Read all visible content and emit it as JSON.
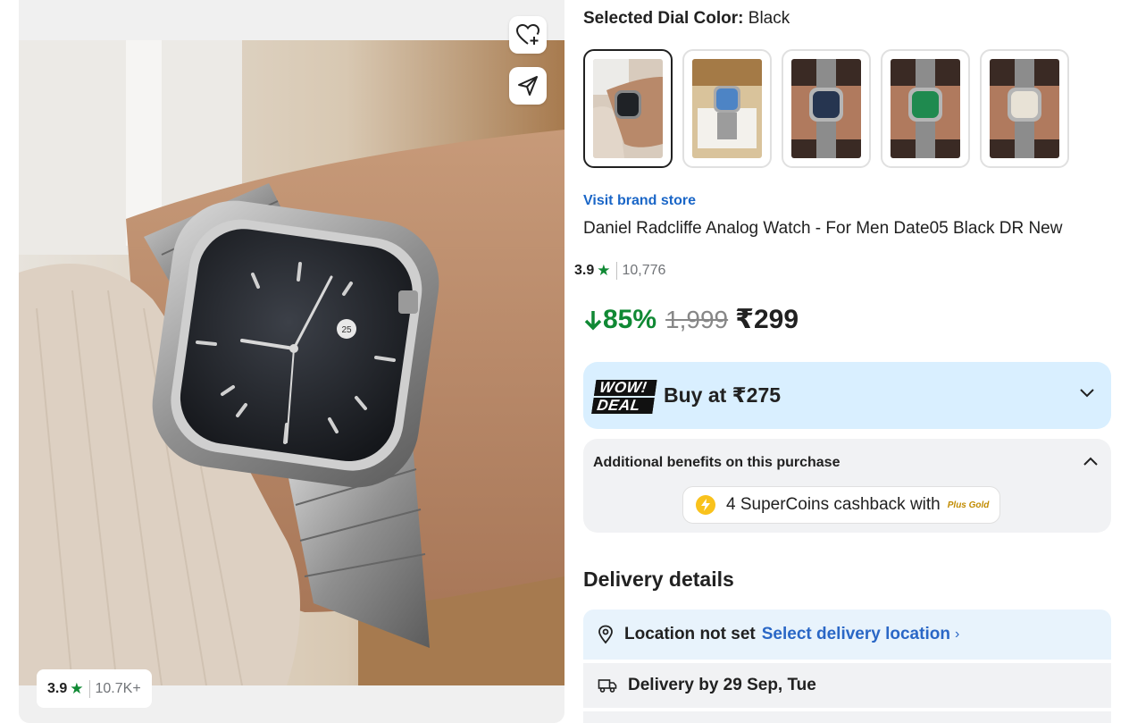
{
  "gallery": {
    "rating": "3.9",
    "rating_count": "10.7K+",
    "wishlist_icon": "heart-plus-icon",
    "share_icon": "share-icon"
  },
  "dial": {
    "label": "Selected Dial Color:",
    "value": "Black",
    "options": [
      "black-dial-on-wrist",
      "blue-dial-in-box",
      "navy-dial-in-hand",
      "green-dial-in-hand",
      "silver-dial-in-hand"
    ]
  },
  "product": {
    "brand_link": "Visit brand store",
    "title": "Daniel Radcliffe Analog Watch  - For Men Date05 Black DR New",
    "rating": "3.9",
    "rating_count": "10,776",
    "discount": "85%",
    "mrp": "1,999",
    "price": "₹299"
  },
  "deal": {
    "badge_line1": "WOW!",
    "badge_line2": "DEAL",
    "text": "Buy at ₹275"
  },
  "benefits": {
    "heading": "Additional benefits on this purchase",
    "supercoins": "4 SuperCoins cashback with",
    "plus_gold": "Plus Gold"
  },
  "delivery": {
    "heading": "Delivery details",
    "location_label": "Location not set",
    "location_link": "Select delivery location",
    "delivery_by": "Delivery by 29 Sep, Tue"
  },
  "colors": {
    "rating_green": "#108934",
    "link_blue": "#2a67c6",
    "deal_bg": "#d9efff",
    "benefits_bg": "#f1f2f4"
  }
}
